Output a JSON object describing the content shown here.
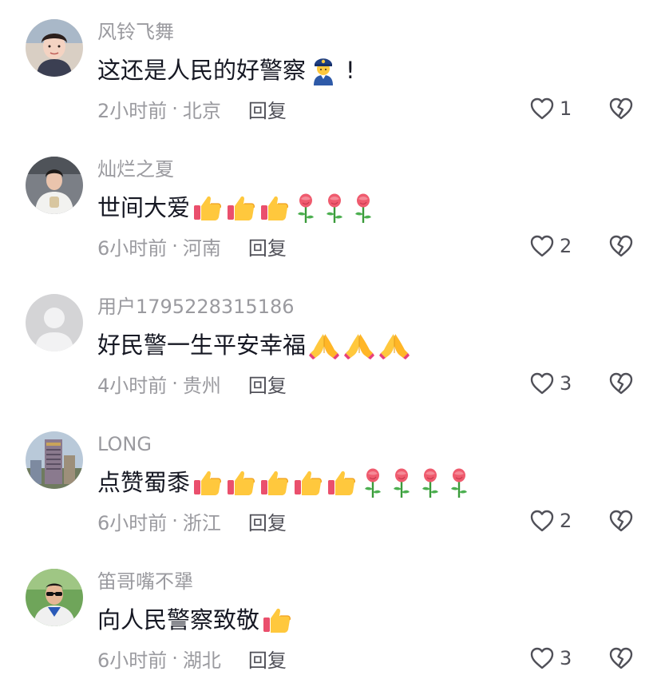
{
  "comments": [
    {
      "username": "风铃飞舞",
      "text": "这还是人民的好警察",
      "emojis": [
        "police-officer-emoji",
        "exclamation"
      ],
      "time": "2小时前",
      "location": "北京",
      "reply_label": "回复",
      "likes": "1",
      "avatar": "woman-portrait"
    },
    {
      "username": "灿烂之夏",
      "text": "世间大爱",
      "emojis": [
        "thumbs-up-emoji",
        "thumbs-up-emoji",
        "thumbs-up-emoji",
        "rose-emoji",
        "rose-emoji",
        "rose-emoji"
      ],
      "time": "6小时前",
      "location": "河南",
      "reply_label": "回复",
      "likes": "2",
      "avatar": "woman-in-white-coat"
    },
    {
      "username": "用户1795228315186",
      "text": "好民警一生平安幸福",
      "emojis": [
        "folded-hands-emoji",
        "folded-hands-emoji",
        "folded-hands-emoji"
      ],
      "time": "4小时前",
      "location": "贵州",
      "reply_label": "回复",
      "likes": "3",
      "avatar": "default-user"
    },
    {
      "username": "LONG",
      "text": "点赞蜀黍",
      "emojis": [
        "thumbs-up-emoji",
        "thumbs-up-emoji",
        "thumbs-up-emoji",
        "thumbs-up-emoji",
        "thumbs-up-emoji",
        "rose-emoji",
        "rose-emoji",
        "rose-emoji",
        "rose-emoji"
      ],
      "time": "6小时前",
      "location": "浙江",
      "reply_label": "回复",
      "likes": "2",
      "avatar": "building-photo"
    },
    {
      "username": "笛哥嘴不犟",
      "text": "向人民警察致敬",
      "emojis": [
        "thumbs-up-emoji"
      ],
      "time": "6小时前",
      "location": "湖北",
      "reply_label": "回复",
      "likes": "3",
      "avatar": "man-with-sunglasses"
    }
  ],
  "separator": "·",
  "colors": {
    "username": "#9a9a9f",
    "text": "#161823",
    "meta": "#9a9a9f",
    "action": "#505058"
  }
}
